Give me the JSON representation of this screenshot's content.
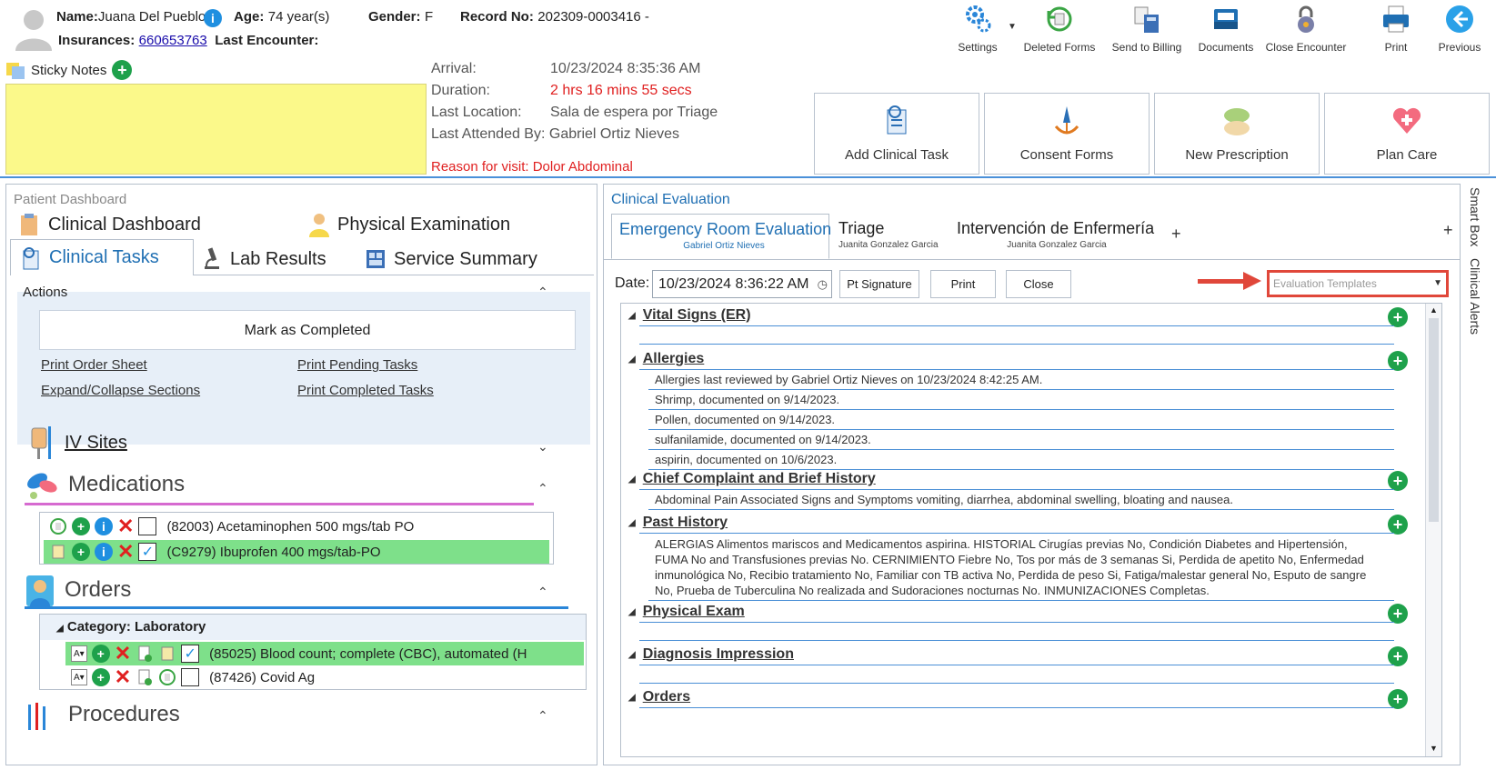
{
  "patient": {
    "name_label": "Name:",
    "name": "Juana Del Pueblo",
    "age_label": "Age:",
    "age": "74 year(s)",
    "gender_label": "Gender:",
    "gender": "F",
    "record_label": "Record No:",
    "record": "202309-0003416 -",
    "insurances_label": "Insurances:",
    "insurances": "660653763",
    "last_encounter_label": "Last Encounter:"
  },
  "toolbar": [
    {
      "label": "Settings",
      "icon": "gear-icon"
    },
    {
      "label": "Deleted Forms",
      "icon": "restore-icon"
    },
    {
      "label": "Send to Billing",
      "icon": "billing-icon"
    },
    {
      "label": "Documents",
      "icon": "inbox-icon"
    },
    {
      "label": "Close Encounter",
      "icon": "lock-icon"
    },
    {
      "label": "Print",
      "icon": "printer-icon"
    },
    {
      "label": "Previous",
      "icon": "back-arrow-icon"
    }
  ],
  "sticky": {
    "title": "Sticky Notes"
  },
  "visit": {
    "arrival_label": "Arrival:",
    "arrival": "10/23/2024 8:35:36 AM",
    "duration_label": "Duration:",
    "duration": "2 hrs 16 mins 55 secs",
    "location_label": "Last Location:",
    "location": "Sala de espera por Triage",
    "attended": "Last Attended By: Gabriel Ortiz Nieves",
    "reason": "Reason for visit: Dolor Abdominal"
  },
  "actions_big": [
    {
      "label": "Add Clinical Task",
      "icon": "clinical-task-icon"
    },
    {
      "label": "Consent Forms",
      "icon": "pen-icon"
    },
    {
      "label": "New Prescription",
      "icon": "pills-icon"
    },
    {
      "label": "Plan Care",
      "icon": "heart-care-icon"
    }
  ],
  "left": {
    "title": "Patient Dashboard",
    "tabs": [
      "Clinical Dashboard",
      "Physical Examination",
      "Clinical Tasks",
      "Lab Results",
      "Service Summary"
    ],
    "actions_title": "Actions",
    "mark_completed": "Mark as Completed",
    "links": [
      "Print Order Sheet",
      "Print Pending Tasks",
      "Expand/Collapse Sections",
      "Print Completed Tasks"
    ],
    "iv_sites": "IV Sites",
    "medications": "Medications",
    "med_items": [
      "(82003) Acetaminophen 500 mgs/tab PO",
      "(C9279) Ibuprofen 400 mgs/tab-PO"
    ],
    "orders": "Orders",
    "category": "Category: Laboratory",
    "order_items": [
      "(85025) Blood count; complete (CBC), automated (H",
      "(87426) Covid Ag"
    ],
    "procedures": "Procedures"
  },
  "right": {
    "title": "Clinical Evaluation",
    "tabs": [
      {
        "title": "Emergency Room Evaluation",
        "sub": "Gabriel Ortiz Nieves"
      },
      {
        "title": "Triage",
        "sub": "Juanita Gonzalez Garcia"
      },
      {
        "title": "Intervención de Enfermería",
        "sub": "Juanita Gonzalez Garcia"
      }
    ],
    "date_label": "Date:",
    "date_value": "10/23/2024 8:36:22 AM",
    "btn_signature": "Pt Signature",
    "btn_print": "Print",
    "btn_close": "Close",
    "templates_placeholder": "Evaluation Templates",
    "sections": {
      "vitals": "Vital Signs (ER)",
      "allergies": "Allergies",
      "chief": "Chief Complaint and Brief History",
      "past": "Past History",
      "physical": "Physical Exam",
      "diagnosis": "Diagnosis Impression",
      "orders": "Orders"
    },
    "allergy_items": [
      "Allergies last reviewed by Gabriel Ortiz Nieves on 10/23/2024 8:42:25 AM.",
      "Shrimp, documented on 9/14/2023.",
      "Pollen, documented on 9/14/2023.",
      "sulfanilamide, documented on 9/14/2023.",
      "aspirin, documented on 10/6/2023."
    ],
    "chief_text": "Abdominal Pain Associated Signs and Symptoms vomiting, diarrhea, abdominal swelling, bloating and nausea.",
    "past_text": "ALERGIAS Alimentos mariscos and Medicamentos aspirina. HISTORIAL Cirugías previas No, Condición Diabetes and Hipertensión, FUMA No and Transfusiones previas No. CERNIMIENTO Fiebre No, Tos por más de 3 semanas Si, Perdida de apetito No, Enfermedad inmunológica No, Recibio tratamiento No, Familiar con TB activa No, Perdida de peso Si, Fatiga/malestar general No, Esputo de sangre No, Prueba de Tuberculina No realizada and Sudoraciones nocturnas No. INMUNIZACIONES Completas."
  },
  "side": {
    "smart_box": "Smart Box",
    "clinical_alerts": "Clinical Alerts"
  }
}
